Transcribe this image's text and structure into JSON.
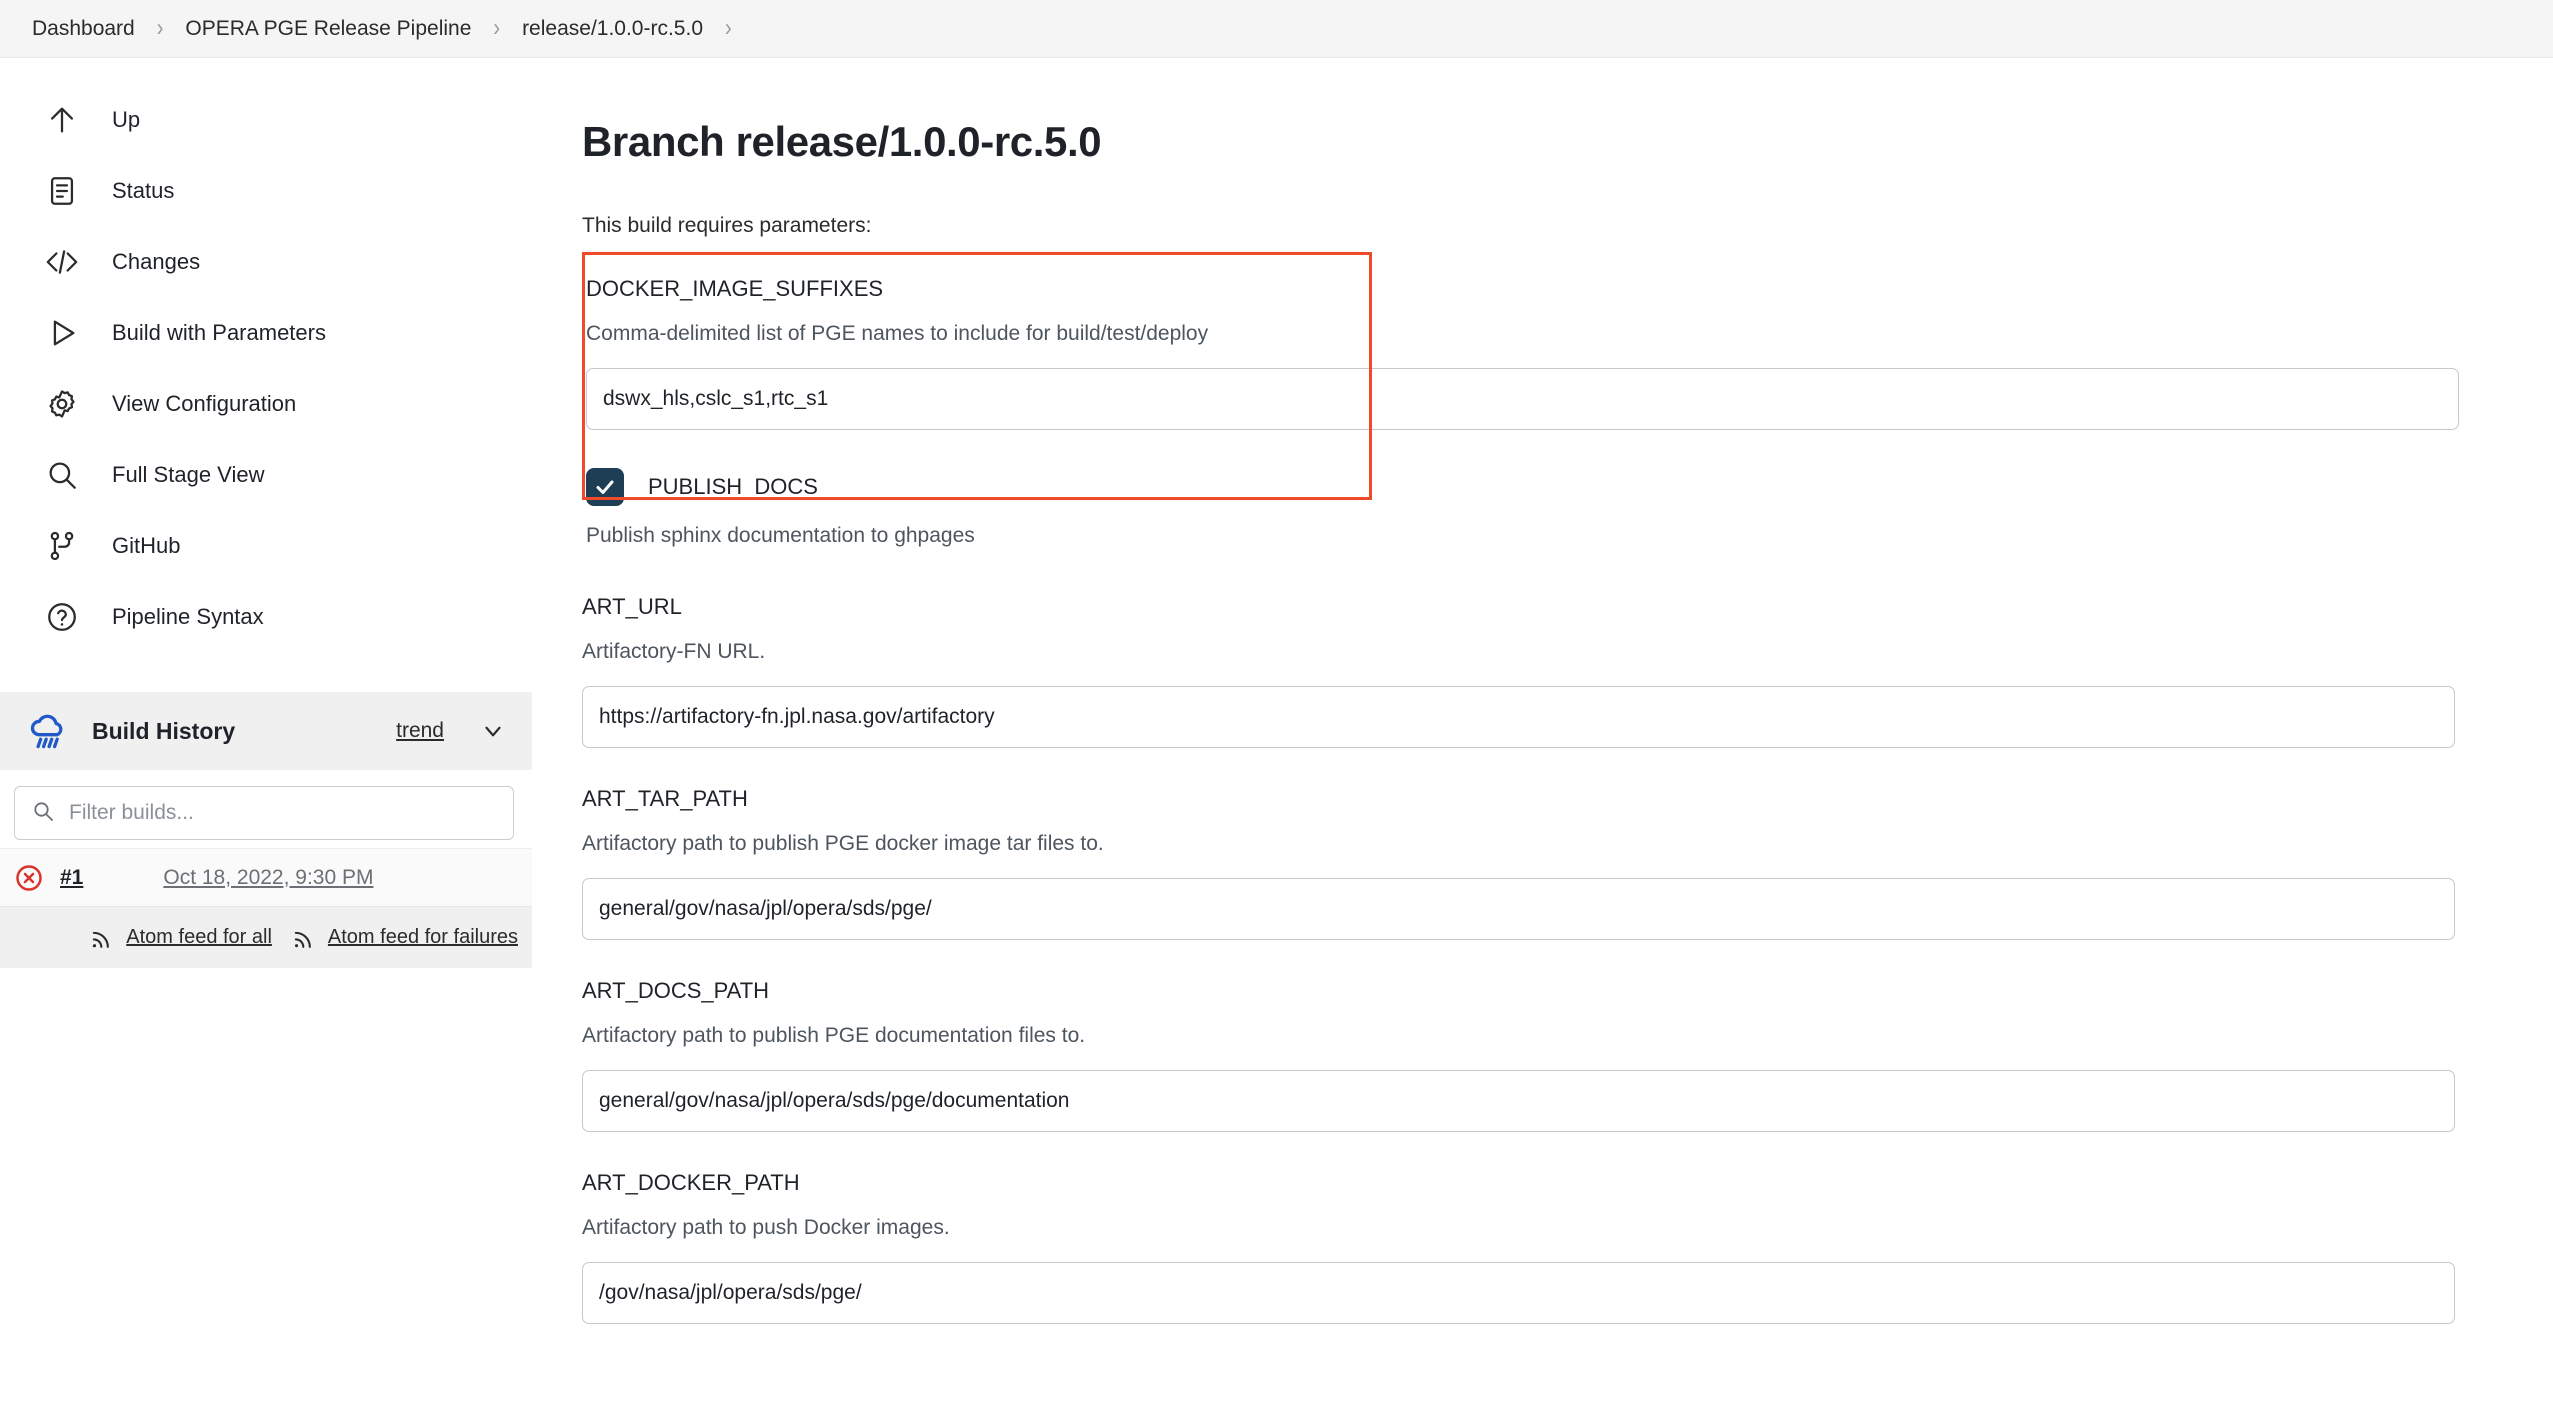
{
  "breadcrumb": {
    "items": [
      "Dashboard",
      "OPERA PGE Release Pipeline",
      "release/1.0.0-rc.5.0"
    ],
    "separator": "›"
  },
  "sidebar": {
    "items": [
      {
        "label": "Up",
        "icon": "arrow-up-icon"
      },
      {
        "label": "Status",
        "icon": "document-icon"
      },
      {
        "label": "Changes",
        "icon": "code-brackets-icon"
      },
      {
        "label": "Build with Parameters",
        "icon": "play-triangle-icon"
      },
      {
        "label": "View Configuration",
        "icon": "gear-icon"
      },
      {
        "label": "Full Stage View",
        "icon": "magnifier-icon"
      },
      {
        "label": "GitHub",
        "icon": "git-branch-icon"
      },
      {
        "label": "Pipeline Syntax",
        "icon": "question-circle-icon"
      }
    ],
    "build_history": {
      "title": "Build History",
      "icon": "rain-cloud-icon",
      "trend_label": "trend",
      "chevron_icon": "chevron-down-icon",
      "filter_placeholder": "Filter builds...",
      "filter_icon": "search-icon",
      "builds": [
        {
          "number": "#1",
          "date": "Oct 18, 2022, 9:30 PM",
          "status": "failed",
          "status_icon": "error-circle-icon"
        }
      ],
      "feeds": [
        {
          "label": "Atom feed for all",
          "icon": "rss-icon"
        },
        {
          "label": "Atom feed for failures",
          "icon": "rss-icon"
        }
      ]
    }
  },
  "main": {
    "title": "Branch release/1.0.0-rc.5.0",
    "requires_text": "This build requires parameters:",
    "parameters": [
      {
        "name": "DOCKER_IMAGE_SUFFIXES",
        "description": "Comma-delimited list of PGE names to include for build/test/deploy",
        "value": "dswx_hls,cslc_s1,rtc_s1",
        "type": "text"
      },
      {
        "name": "PUBLISH_DOCS",
        "description": "Publish sphinx documentation to ghpages",
        "checked": true,
        "type": "checkbox"
      },
      {
        "name": "ART_URL",
        "description": "Artifactory-FN URL.",
        "value": "https://artifactory-fn.jpl.nasa.gov/artifactory",
        "type": "text"
      },
      {
        "name": "ART_TAR_PATH",
        "description": "Artifactory path to publish PGE docker image tar files to.",
        "value": "general/gov/nasa/jpl/opera/sds/pge/",
        "type": "text"
      },
      {
        "name": "ART_DOCS_PATH",
        "description": "Artifactory path to publish PGE documentation files to.",
        "value": "general/gov/nasa/jpl/opera/sds/pge/documentation",
        "type": "text"
      },
      {
        "name": "ART_DOCKER_PATH",
        "description": "Artifactory path to push Docker images.",
        "value": "/gov/nasa/jpl/opera/sds/pge/",
        "type": "text"
      }
    ]
  },
  "colors": {
    "highlight_border": "#f04a2a",
    "checkbox_fill": "#1d3e55",
    "failure_red": "#d9342b",
    "cloud_blue": "#2159c7"
  }
}
